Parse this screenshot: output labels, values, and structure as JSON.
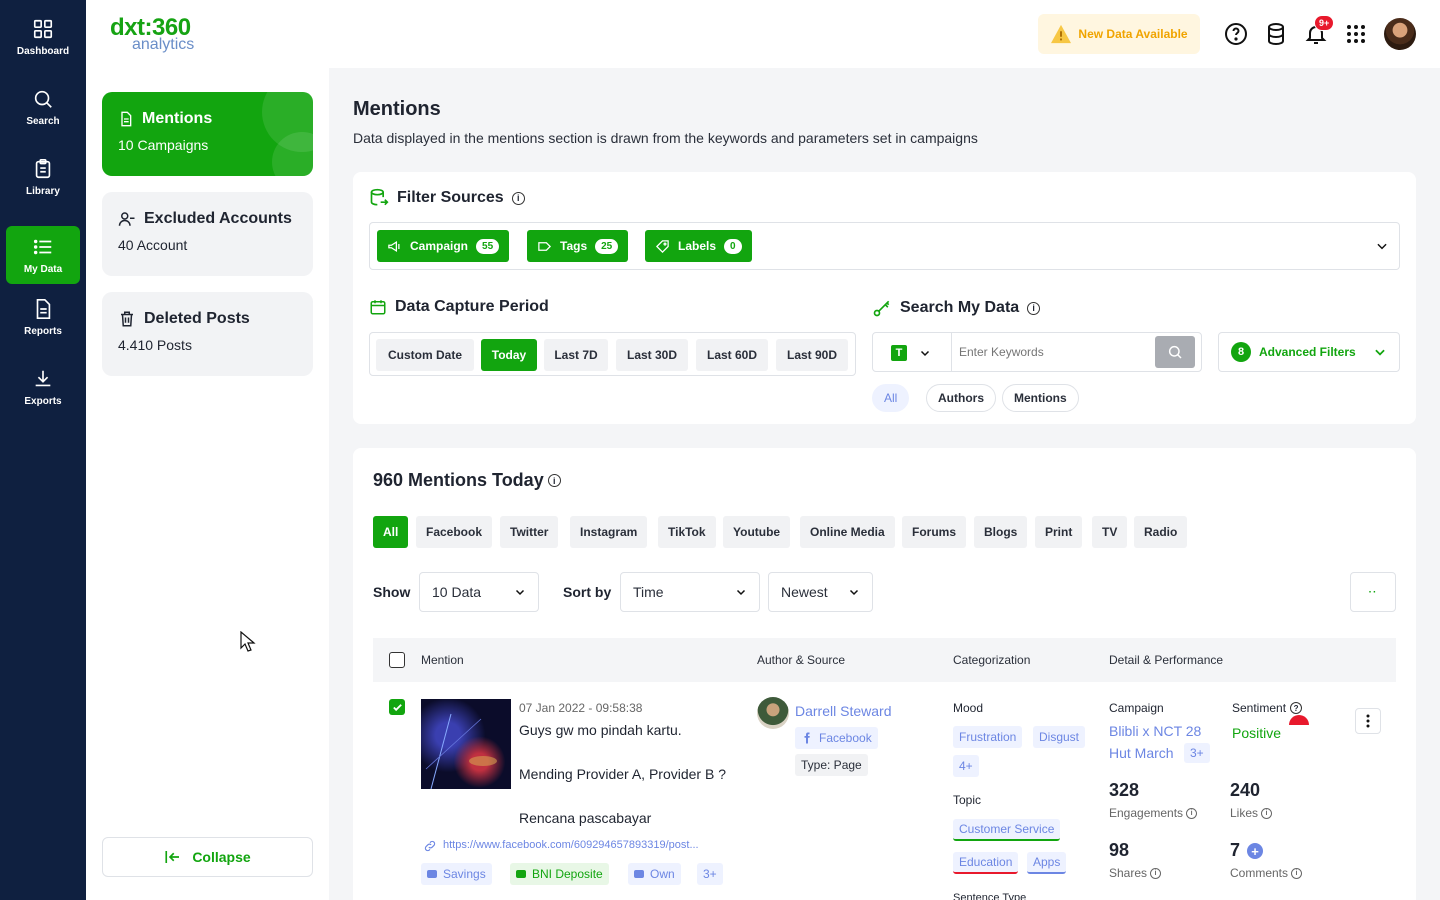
{
  "rail": {
    "items": [
      {
        "label": "Dashboard",
        "icon": "grid-icon"
      },
      {
        "label": "Search",
        "icon": "search-icon"
      },
      {
        "label": "Library",
        "icon": "clipboard-icon"
      },
      {
        "label": "My Data",
        "icon": "list-icon",
        "active": true
      },
      {
        "label": "Reports",
        "icon": "document-icon"
      },
      {
        "label": "Exports",
        "icon": "download-icon"
      }
    ]
  },
  "logo": {
    "top": "dxt:360",
    "bottom": "analytics"
  },
  "panel": {
    "cards": [
      {
        "title": "Mentions",
        "subtitle": "10 Campaigns"
      },
      {
        "title": "Excluded Accounts",
        "subtitle": "40 Account"
      },
      {
        "title": "Deleted Posts",
        "subtitle": "4.410 Posts"
      }
    ],
    "collapse_label": "Collapse"
  },
  "topbar": {
    "new_data": "New Data Available",
    "notif_count": "9+"
  },
  "page": {
    "title": "Mentions",
    "subtitle": "Data displayed in the mentions section is drawn from the keywords and parameters set in campaigns"
  },
  "filter": {
    "title": "Filter Sources",
    "chips": [
      {
        "label": "Campaign",
        "count": "55"
      },
      {
        "label": "Tags",
        "count": "25"
      },
      {
        "label": "Labels",
        "count": "0"
      }
    ]
  },
  "capture": {
    "title": "Data Capture Period",
    "options": [
      "Custom Date",
      "Today",
      "Last 7D",
      "Last 30D",
      "Last 60D",
      "Last 90D"
    ],
    "selected": "Today"
  },
  "search": {
    "title": "Search My Data",
    "placeholder": "Enter Keywords",
    "type_badge": "T",
    "advanced_label": "Advanced Filters",
    "advanced_count": "8",
    "scopes": [
      "All",
      "Authors",
      "Mentions"
    ]
  },
  "mentions": {
    "title": "960 Mentions Today",
    "sources": [
      "All",
      "Facebook",
      "Twitter",
      "Instagram",
      "TikTok",
      "Youtube",
      "Online Media",
      "Forums",
      "Blogs",
      "Print",
      "TV",
      "Radio"
    ],
    "show_label": "Show",
    "show_value": "10 Data",
    "sort_label": "Sort by",
    "sort_value": "Time",
    "order_value": "Newest",
    "columns": [
      "Mention",
      "Author & Source",
      "Categorization",
      "Detail & Performance"
    ],
    "row": {
      "date": "07 Jan 2022 - 09:58:38",
      "line1": "Guys gw mo pindah kartu.",
      "line2": "Mending Provider A, Provider B ?",
      "line3": "Rencana pascabayar",
      "link": "https://www.facebook.com/609294657893319/post...",
      "tags": [
        "Savings",
        "BNI Deposite",
        "Own",
        "3+"
      ],
      "author": "Darrell Steward",
      "platform": "Facebook",
      "type": "Type: Page",
      "mood_label": "Mood",
      "moods": [
        "Frustration",
        "Disgust",
        "4+"
      ],
      "topic_label": "Topic",
      "topics": [
        "Customer Service",
        "Education",
        "Apps"
      ],
      "sentence_type_label": "Sentence Type",
      "campaign_label": "Campaign",
      "campaign_line1": "Blibli x NCT 28",
      "campaign_line2": "Hut March",
      "campaign_more": "3+",
      "sentiment_label": "Sentiment",
      "sentiment_value": "Positive",
      "engagements": "328",
      "engagements_label": "Engagements",
      "likes": "240",
      "likes_label": "Likes",
      "shares": "98",
      "shares_label": "Shares",
      "comments": "7",
      "comments_label": "Comments"
    }
  },
  "colors": {
    "brand": "#12a50f",
    "rail": "#0f2040",
    "accent_blue": "#6c86e3",
    "warning": "#f0a400"
  }
}
